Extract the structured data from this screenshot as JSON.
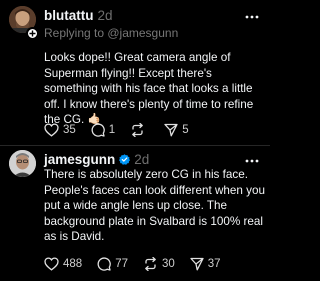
{
  "posts": [
    {
      "username": "blutattu",
      "time": "2d",
      "reply_to": "Replying to @jamesgunn",
      "text": "Looks dope!! Great camera angle of Superman flying!! Except there's something with his face that looks a little off. I know there's plenty of time to refine the CG. 🤙🏻",
      "likes": "35",
      "replies": "1",
      "reposts": "",
      "shares": "5"
    },
    {
      "username": "jamesgunn",
      "time": "2d",
      "text": "There is absolutely zero CG in his face. People's faces can look different when you put a wide angle lens up close. The background plate in Svalbard is 100% real as is David.",
      "likes": "488",
      "replies": "77",
      "reposts": "30",
      "shares": "37"
    }
  ],
  "colors": {
    "background": "#000000",
    "text": "#f3f5f7",
    "muted": "#777777",
    "verified": "#0095f6"
  }
}
